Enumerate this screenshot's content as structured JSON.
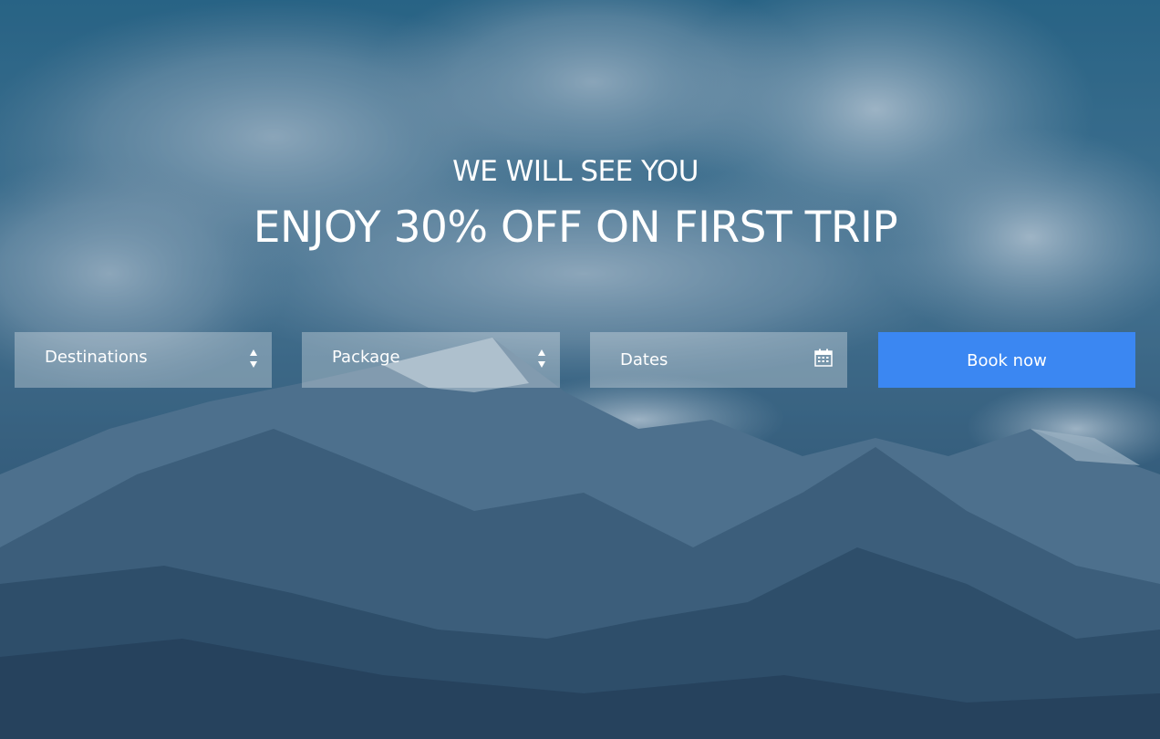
{
  "hero": {
    "subtitle": "WE WILL SEE YOU",
    "title": "ENJOY 30% OFF ON FIRST TRIP"
  },
  "booking": {
    "destinations_label": "Destinations",
    "package_label": "Package",
    "dates_label": "Dates",
    "book_label": "Book now"
  },
  "icons": {
    "select_arrows": "updown-arrows-icon",
    "calendar": "calendar-icon"
  },
  "colors": {
    "book_button": "#3b87f2",
    "overlay": "#2c5778",
    "text": "#ffffff"
  }
}
